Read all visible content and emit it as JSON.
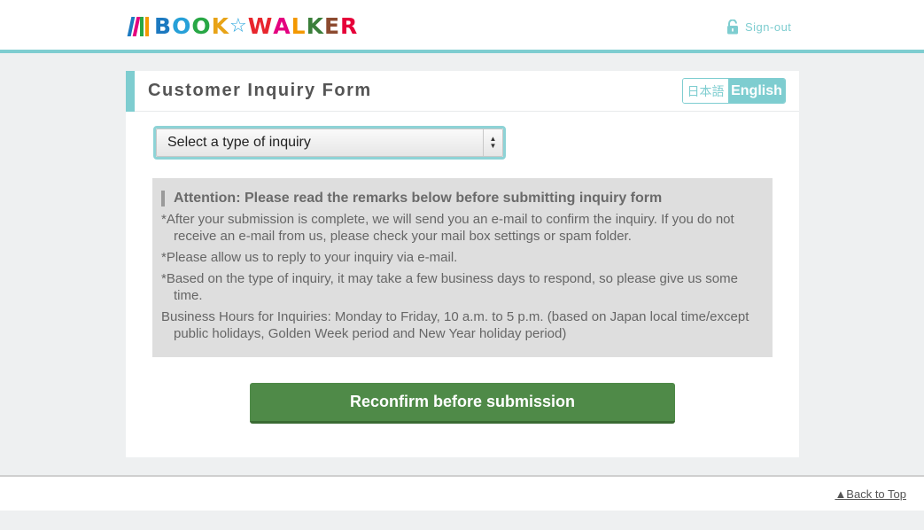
{
  "header": {
    "logo": {
      "letters": [
        "B",
        "O",
        "O",
        "K",
        "☆",
        "W",
        "A",
        "L",
        "K",
        "E",
        "R"
      ],
      "letter_colors": [
        "#1c79c0",
        "#27a0d8",
        "#28a745",
        "#e8a317",
        "#2aa6de",
        "#e8262d",
        "#e4007f",
        "#f39800",
        "#3b7f3b",
        "#8c4a2f",
        "#e60039"
      ],
      "bar_colors": [
        "#1c79c0",
        "#e4007f",
        "#28a745",
        "#f39800"
      ]
    },
    "signout_label": "Sign-out",
    "accent_color": "#7ecdd0"
  },
  "panel": {
    "title": "Customer Inquiry Form",
    "lang_ja": "日本語",
    "lang_en": "English",
    "select": {
      "value": "Select a type of inquiry"
    },
    "notice": {
      "title": "Attention: Please read the remarks below before submitting inquiry form",
      "items": [
        "*After your submission is complete, we will send you an e-mail to confirm the inquiry. If you do not receive an e-mail from us, please check your mail box settings or spam folder.",
        "*Please allow us to reply to your inquiry via e-mail.",
        "*Based on the type of inquiry, it may take a few business days to respond, so please give us some time.",
        "Business Hours for Inquiries: Monday to Friday, 10 a.m. to 5 p.m. (based on Japan local time/except public holidays, Golden Week period and New Year holiday period)"
      ]
    },
    "submit_label": "Reconfirm before submission",
    "submit_color": "#4f8a48"
  },
  "footer": {
    "back_to_top": "▲Back to Top"
  }
}
